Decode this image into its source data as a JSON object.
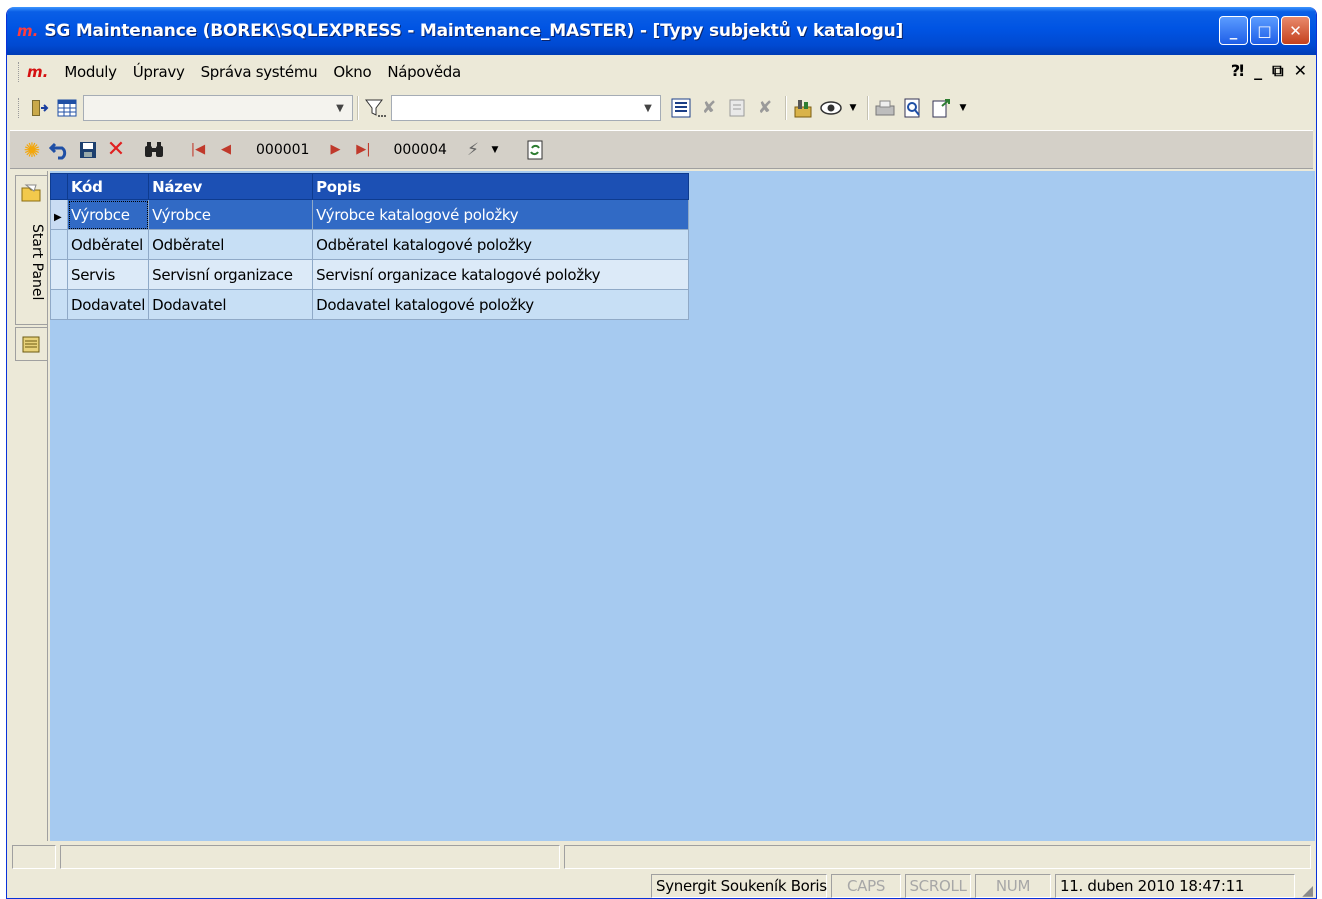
{
  "window": {
    "logo": "m.",
    "title": "SG Maintenance (BOREK\\SQLEXPRESS - Maintenance_MASTER) - [Typy subjektů v katalogu]",
    "buttons": {
      "minimize": "_",
      "maximize": "□",
      "close": "✕"
    }
  },
  "menubar": {
    "logo": "m.",
    "items": [
      "Moduly",
      "Úpravy",
      "Správa systému",
      "Okno",
      "Nápověda"
    ],
    "right": {
      "help": "⁈",
      "minimize": "_",
      "restore": "⧉",
      "close": "✕"
    }
  },
  "toolbar1": {
    "view_combo_value": "",
    "filter_combo_value": "",
    "icons": [
      "exit-icon",
      "grid-icon",
      "filter-icon",
      "report-icon",
      "flag-icon",
      "form-icon",
      "flag2-icon",
      "tools-icon",
      "eye-icon",
      "print-icon",
      "preview-icon",
      "export-icon"
    ]
  },
  "toolbar2": {
    "current_record": "000001",
    "total_records": "000004",
    "icons": [
      "new-icon",
      "undo-icon",
      "save-icon",
      "delete-icon",
      "find-icon",
      "first-icon",
      "prev-icon",
      "next-icon",
      "last-icon",
      "wand-icon",
      "refresh-icon"
    ]
  },
  "sidepanel": {
    "label": "Start Panel"
  },
  "grid": {
    "columns": [
      "Kód",
      "Název",
      "Popis"
    ],
    "rows": [
      [
        "Výrobce",
        "Výrobce",
        "Výrobce katalogové položky"
      ],
      [
        "Odběratel",
        "Odběratel",
        "Odběratel katalogové položky"
      ],
      [
        "Servis",
        "Servisní organizace",
        "Servisní organizace katalogové položky"
      ],
      [
        "Dodavatel",
        "Dodavatel",
        "Dodavatel katalogové položky"
      ]
    ],
    "selected_row": 0
  },
  "statusbar": {
    "user": "Synergit Soukeník Boris",
    "caps": "CAPS",
    "scroll": "SCROLL",
    "num": "NUM",
    "datetime": "11. duben 2010 18:47:11"
  },
  "colors": {
    "titlebar": "#0054e3",
    "grid_header": "#1c50b4",
    "grid_selected": "#316ac5",
    "content_bg": "#a6caf0"
  }
}
